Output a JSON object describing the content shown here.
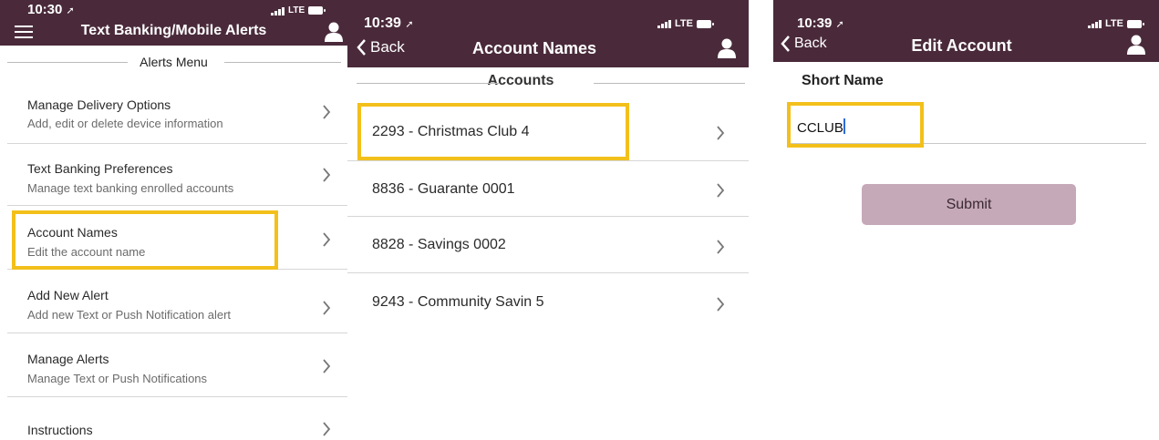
{
  "colors": {
    "header_bg": "#4a2a3a",
    "highlight": "#f3c01b",
    "submit_bg": "#c6a9b8"
  },
  "screen1": {
    "status": {
      "time": "10:30",
      "network": "LTE"
    },
    "title": "Text Banking/Mobile Alerts",
    "section": "Alerts Menu",
    "items": [
      {
        "title": "Manage Delivery Options",
        "subtitle": "Add, edit or delete device information"
      },
      {
        "title": "Text Banking Preferences",
        "subtitle": "Manage text banking enrolled accounts"
      },
      {
        "title": "Account Names",
        "subtitle": "Edit the account name"
      },
      {
        "title": "Add New Alert",
        "subtitle": "Add new Text or Push Notification alert"
      },
      {
        "title": "Manage Alerts",
        "subtitle": "Manage Text or Push Notifications"
      },
      {
        "title": "Instructions",
        "subtitle": ""
      }
    ]
  },
  "screen2": {
    "status": {
      "time": "10:39",
      "network": "LTE"
    },
    "back_label": "Back",
    "title": "Account Names",
    "section": "Accounts",
    "accounts": [
      "2293 - Christmas Club 4",
      "8836 - Guarante 0001",
      "8828 - Savings 0002",
      "9243 - Community Savin 5"
    ]
  },
  "screen3": {
    "status": {
      "time": "10:39",
      "network": "LTE"
    },
    "back_label": "Back",
    "title": "Edit Account",
    "field_label": "Short Name",
    "field_value": "CCLUB",
    "submit_label": "Submit"
  }
}
